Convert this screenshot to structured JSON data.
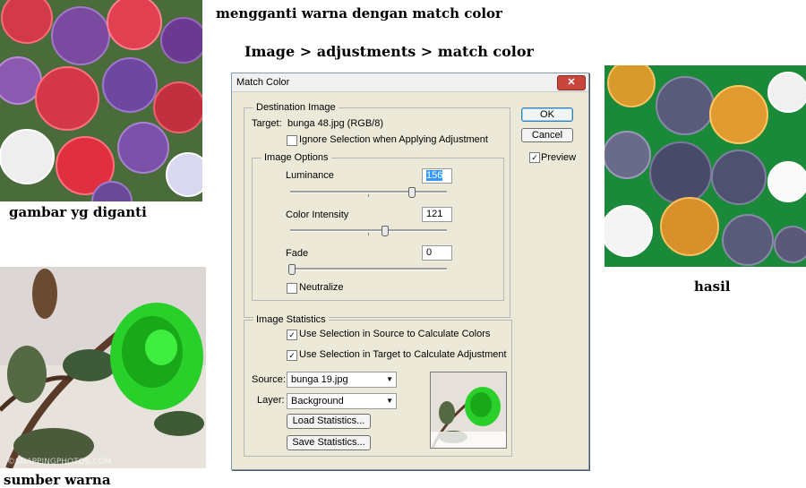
{
  "captions": {
    "heading": "mengganti warna dengan match color",
    "menu_path": "Image > adjustments > match color",
    "target_caption": "gambar yg diganti",
    "source_caption": "sumber warna",
    "result_caption": "hasil"
  },
  "dialog": {
    "title": "Match Color",
    "close_glyph": "✕",
    "ok_label": "OK",
    "cancel_label": "Cancel",
    "preview_label": "Preview",
    "preview_checked": true,
    "destination": {
      "group_label": "Destination Image",
      "target_label": "Target:",
      "target_value": "bunga 48.jpg (RGB/8)",
      "ignore_selection_label": "Ignore Selection when Applying Adjustment",
      "ignore_selection_checked": false
    },
    "image_options": {
      "group_label": "Image Options",
      "luminance_label": "Luminance",
      "luminance_value": "156",
      "color_intensity_label": "Color Intensity",
      "color_intensity_value": "121",
      "fade_label": "Fade",
      "fade_value": "0",
      "neutralize_label": "Neutralize",
      "neutralize_checked": false
    },
    "statistics": {
      "group_label": "Image Statistics",
      "use_source_label": "Use Selection in Source to Calculate Colors",
      "use_source_checked": true,
      "use_target_label": "Use Selection in Target to Calculate Adjustment",
      "use_target_checked": true,
      "source_label": "Source:",
      "source_value": "bunga 19.jpg",
      "layer_label": "Layer:",
      "layer_value": "Background",
      "load_label": "Load Statistics...",
      "save_label": "Save Statistics..."
    }
  },
  "watermark": "©SNAPPINGPHOTOS.COM"
}
